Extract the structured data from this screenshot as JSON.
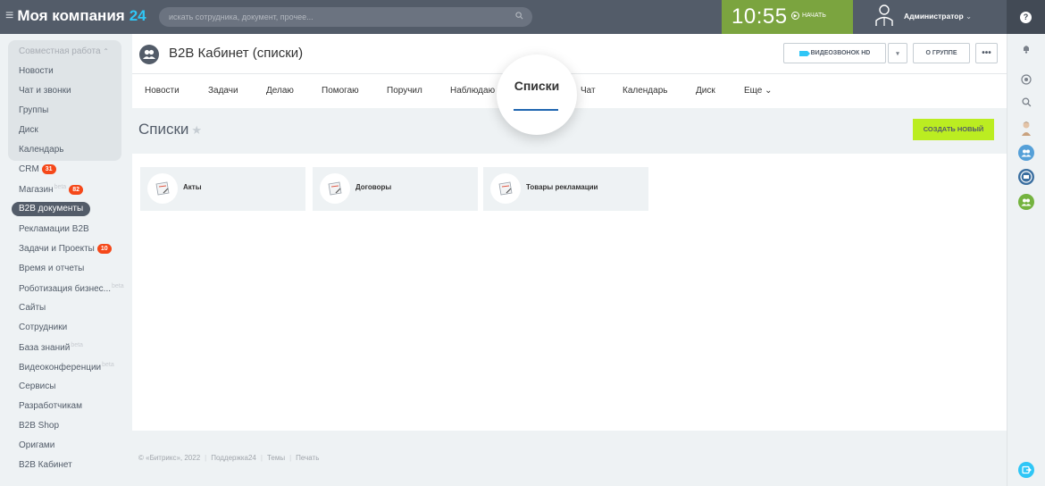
{
  "topbar": {
    "brand_name": "Моя компания",
    "brand_number": "24",
    "search_placeholder": "искать сотрудника, документ, прочее...",
    "time": "10:55",
    "start_label": "НАЧАТЬ",
    "user_name": "Администратор"
  },
  "leftmenu": {
    "section_header": "Совместная работа",
    "items": [
      {
        "label": "Новости"
      },
      {
        "label": "Чат и звонки"
      },
      {
        "label": "Группы"
      },
      {
        "label": "Диск"
      },
      {
        "label": "Календарь"
      },
      {
        "label": "CRM",
        "badge": "31"
      },
      {
        "label": "Магазин",
        "beta": "beta",
        "badge": "82"
      },
      {
        "label": "B2B документы",
        "active": true
      },
      {
        "label": "Рекламации B2B"
      },
      {
        "label": "Задачи и Проекты",
        "badge": "10"
      },
      {
        "label": "Время и отчеты"
      },
      {
        "label": "Роботизация бизнес...",
        "beta": "beta"
      },
      {
        "label": "Сайты"
      },
      {
        "label": "Сотрудники"
      },
      {
        "label": "База знаний",
        "beta": "beta"
      },
      {
        "label": "Видеоконференции",
        "beta": "beta"
      },
      {
        "label": "Сервисы"
      },
      {
        "label": "Разработчикам"
      },
      {
        "label": "B2B Shop"
      },
      {
        "label": "Оригами"
      },
      {
        "label": "B2B Кабинет"
      }
    ]
  },
  "group": {
    "title": "B2B Кабинет (списки)",
    "video_button": "ВИДЕОЗВОНОК HD",
    "about_button": "О ГРУППЕ",
    "more_button": "•••"
  },
  "tabs": [
    {
      "label": "Новости"
    },
    {
      "label": "Задачи"
    },
    {
      "label": "Делаю"
    },
    {
      "label": "Помогаю"
    },
    {
      "label": "Поручил"
    },
    {
      "label": "Наблюдаю"
    },
    {
      "label": "Списки",
      "active": true
    },
    {
      "label": "Чат"
    },
    {
      "label": "Календарь"
    },
    {
      "label": "Диск"
    },
    {
      "label": "Еще ⌄"
    }
  ],
  "page": {
    "title": "Списки",
    "create_button": "СОЗДАТЬ НОВЫЙ"
  },
  "lists": [
    {
      "label": "Акты"
    },
    {
      "label": "Договоры"
    },
    {
      "label": "Товары рекламации"
    }
  ],
  "footer": {
    "copyright": "© «Битрикс», 2022",
    "support": "Поддержка24",
    "themes": "Темы",
    "print": "Печать"
  },
  "colors": {
    "topbar": "#535c69",
    "clock": "#7ba43f",
    "create_button": "#bbed21",
    "badge": "#f54819",
    "active_tab_underline": "#2066b0"
  }
}
